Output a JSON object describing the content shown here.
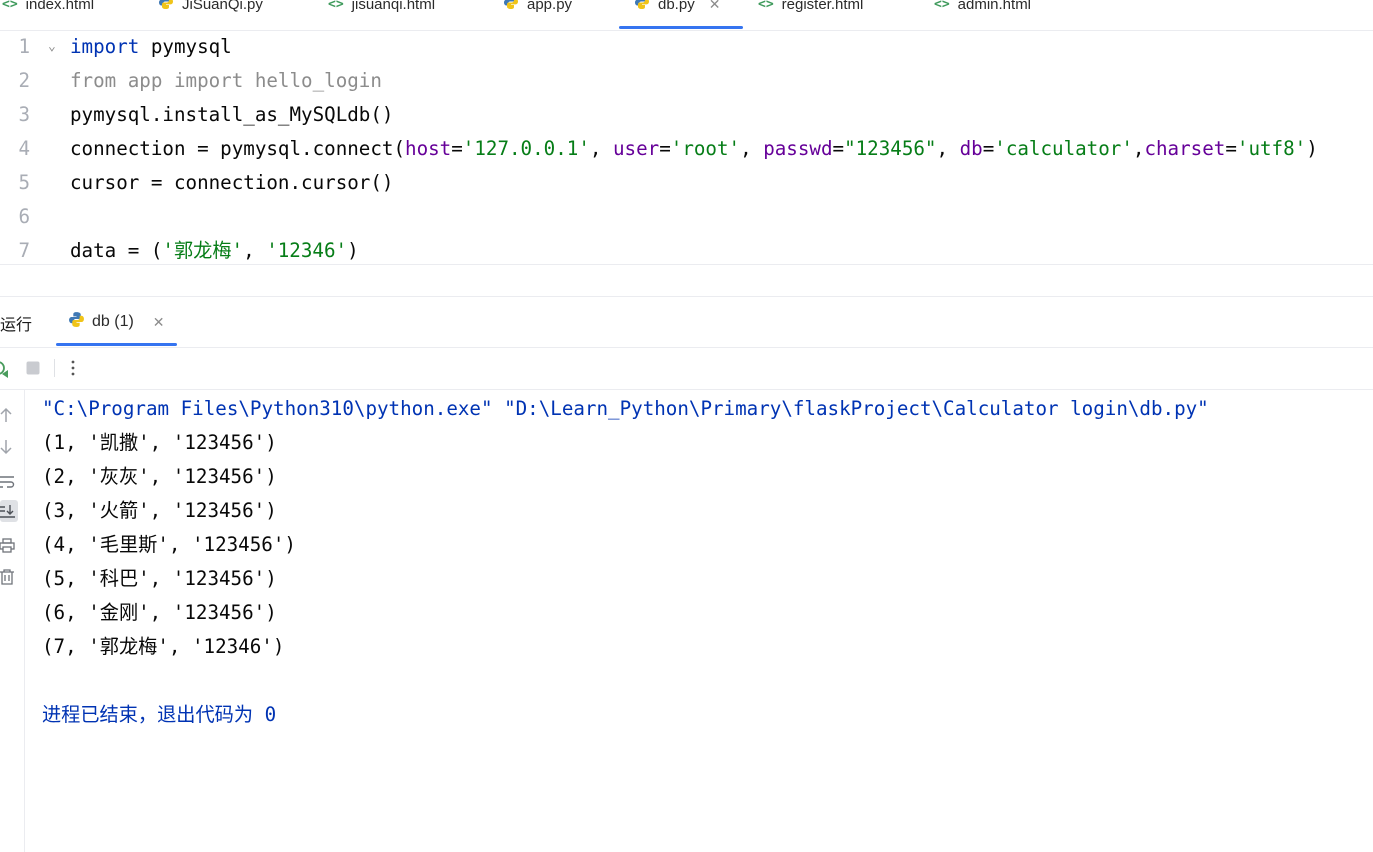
{
  "tabs": [
    {
      "label": "index.html",
      "icon": "html-file-icon"
    },
    {
      "label": "JiSuanQi.py",
      "icon": "python-file-icon"
    },
    {
      "label": "jisuanqi.html",
      "icon": "html-file-icon"
    },
    {
      "label": "app.py",
      "icon": "python-file-icon"
    },
    {
      "label": "db.py",
      "icon": "python-file-icon",
      "active": true
    },
    {
      "label": "register.html",
      "icon": "html-file-icon"
    },
    {
      "label": "admin.html",
      "icon": "html-file-icon"
    }
  ],
  "editor": {
    "lines": [
      {
        "num": "1",
        "t": [
          {
            "c": "kw",
            "v": "import"
          },
          {
            "c": "",
            "v": " pymysql"
          }
        ]
      },
      {
        "num": "2",
        "t": [
          {
            "c": "dim",
            "v": "from app import hello_login"
          }
        ]
      },
      {
        "num": "3",
        "t": [
          {
            "c": "",
            "v": "pymysql.install_as_MySQLdb()"
          }
        ]
      },
      {
        "num": "4",
        "t": [
          {
            "c": "",
            "v": "connection = pymysql.connect("
          },
          {
            "c": "prm",
            "v": "host"
          },
          {
            "c": "",
            "v": "="
          },
          {
            "c": "str",
            "v": "'127.0.0.1'"
          },
          {
            "c": "",
            "v": ", "
          },
          {
            "c": "prm",
            "v": "user"
          },
          {
            "c": "",
            "v": "="
          },
          {
            "c": "str",
            "v": "'root'"
          },
          {
            "c": "",
            "v": ", "
          },
          {
            "c": "prm",
            "v": "passwd"
          },
          {
            "c": "",
            "v": "="
          },
          {
            "c": "str",
            "v": "\"123456\""
          },
          {
            "c": "",
            "v": ", "
          },
          {
            "c": "prm",
            "v": "db"
          },
          {
            "c": "",
            "v": "="
          },
          {
            "c": "str",
            "v": "'calculator'"
          },
          {
            "c": "",
            "v": ","
          },
          {
            "c": "prm",
            "v": "charset"
          },
          {
            "c": "",
            "v": "="
          },
          {
            "c": "str",
            "v": "'utf8'"
          },
          {
            "c": "",
            "v": ")"
          }
        ]
      },
      {
        "num": "5",
        "t": [
          {
            "c": "",
            "v": "cursor = connection.cursor()"
          }
        ]
      },
      {
        "num": "6",
        "t": []
      },
      {
        "num": "7",
        "t": [
          {
            "c": "",
            "v": "data = ("
          },
          {
            "c": "str",
            "v": "'郭龙梅'"
          },
          {
            "c": "",
            "v": ", "
          },
          {
            "c": "str",
            "v": "'12346'"
          },
          {
            "c": "",
            "v": ")"
          }
        ]
      }
    ]
  },
  "run_panel": {
    "title": "运行",
    "tab_label": "db (1)"
  },
  "console": {
    "command": "\"C:\\Program Files\\Python310\\python.exe\" \"D:\\Learn_Python\\Primary\\flaskProject\\Calculator login\\db.py\"",
    "rows": [
      "(1, '凯撒', '123456')",
      "(2, '灰灰', '123456')",
      "(3, '火箭', '123456')",
      "(4, '毛里斯', '123456')",
      "(5, '科巴', '123456')",
      "(6, '金刚', '123456')",
      "(7, '郭龙梅', '12346')"
    ],
    "exit_message": "进程已结束，退出代码为 0"
  },
  "colors": {
    "accent": "#3574f0",
    "keyword": "#0033b3",
    "string": "#067d17",
    "param": "#660099",
    "comment_dim": "#8c8c8c"
  }
}
